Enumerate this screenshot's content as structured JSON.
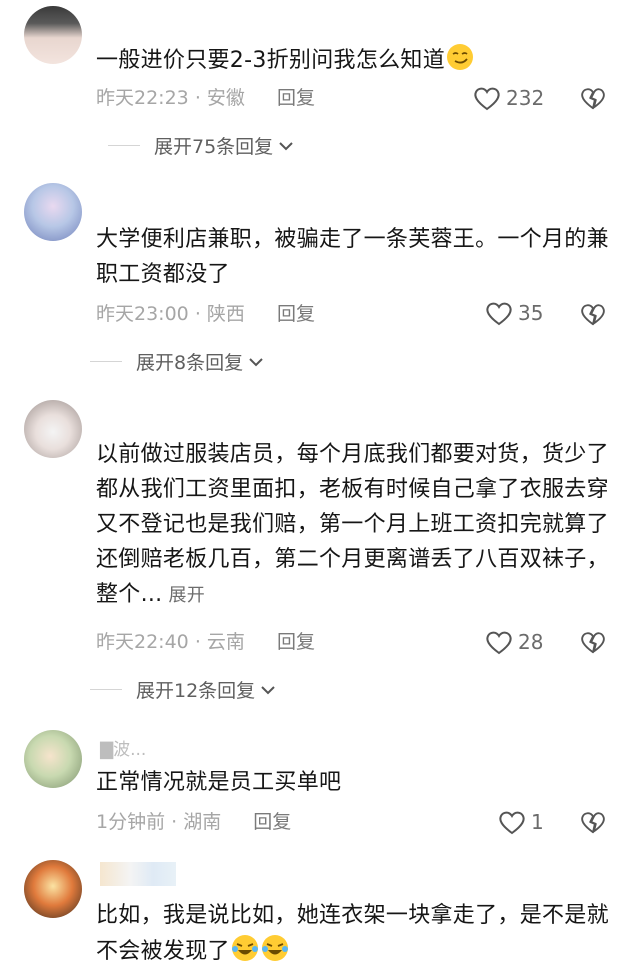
{
  "comments": [
    {
      "username": "",
      "text": "一般进价只要2-3折别问我怎么知道",
      "time": "昨天22:23",
      "location": "安徽",
      "reply": "回复",
      "likes": "232",
      "expand": "展开75条回复",
      "emoji": "smirk-emoji"
    },
    {
      "username": "",
      "text": "大学便利店兼职，被骗走了一条芙蓉王。一个月的兼职工资都没了",
      "time": "昨天23:00",
      "location": "陕西",
      "reply": "回复",
      "likes": "35",
      "expand": "展开8条回复"
    },
    {
      "username": "",
      "text": "以前做过服装店员，每个月底我们都要对货，货少了都从我们工资里面扣，老板有时候自己拿了衣服去穿又不登记也是我们赔，第一个月上班工资扣完就算了还倒赔老板几百，第二个月更离谱丢了八百双袜子，整个...",
      "more": "展开",
      "time": "昨天22:40",
      "location": "云南",
      "reply": "回复",
      "likes": "28",
      "expand": "展开12条回复"
    },
    {
      "username": "▇波...",
      "text": "正常情况就是员工买单吧",
      "time": "1分钟前",
      "location": "湖南",
      "reply": "回复",
      "likes": "1"
    },
    {
      "username": "",
      "text": "比如，我是说比如，她连衣架一块拿走了，是不是就不会被发现了",
      "emoji": "laugh-cry-emoji"
    }
  ],
  "separator": "·"
}
